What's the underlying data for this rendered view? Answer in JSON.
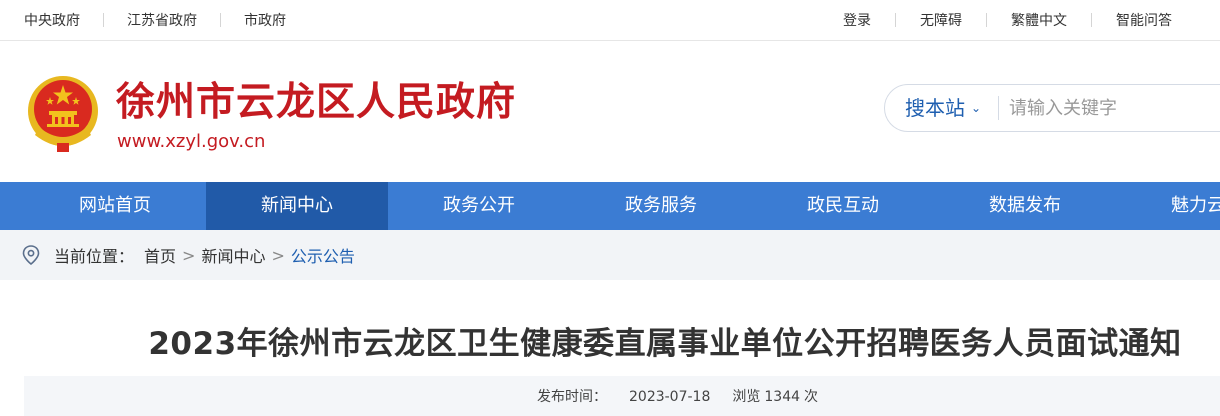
{
  "topbar": {
    "left_links": [
      "中央政府",
      "江苏省政府",
      "市政府"
    ],
    "right_links": [
      "登录",
      "无障碍",
      "繁體中文",
      "智能问答"
    ]
  },
  "header": {
    "site_title": "徐州市云龙区人民政府",
    "site_url": "www.xzyl.gov.cn",
    "search_scope": "搜本站",
    "search_placeholder": "请输入关键字"
  },
  "nav": {
    "items": [
      "网站首页",
      "新闻中心",
      "政务公开",
      "政务服务",
      "政民互动",
      "数据发布",
      "魅力云龙"
    ],
    "active_index": 1
  },
  "breadcrumb": {
    "label": "当前位置：",
    "items": [
      "首页",
      "新闻中心",
      "公示公告"
    ],
    "separator": ">"
  },
  "article": {
    "title": "2023年徐州市云龙区卫生健康委直属事业单位公开招聘医务人员面试通知",
    "publish_label": "发布时间：",
    "publish_date": "2023-07-18",
    "views_label": "浏览",
    "views_count": "1344",
    "views_unit": "次"
  },
  "colors": {
    "brand_red": "#c41b21",
    "nav_blue": "#3b7cd3",
    "nav_active": "#215aa8",
    "link_blue": "#1f5fb0"
  },
  "icons": {
    "emblem": "national-emblem-icon",
    "location": "location-pin-icon",
    "dropdown": "chevron-down-icon"
  }
}
